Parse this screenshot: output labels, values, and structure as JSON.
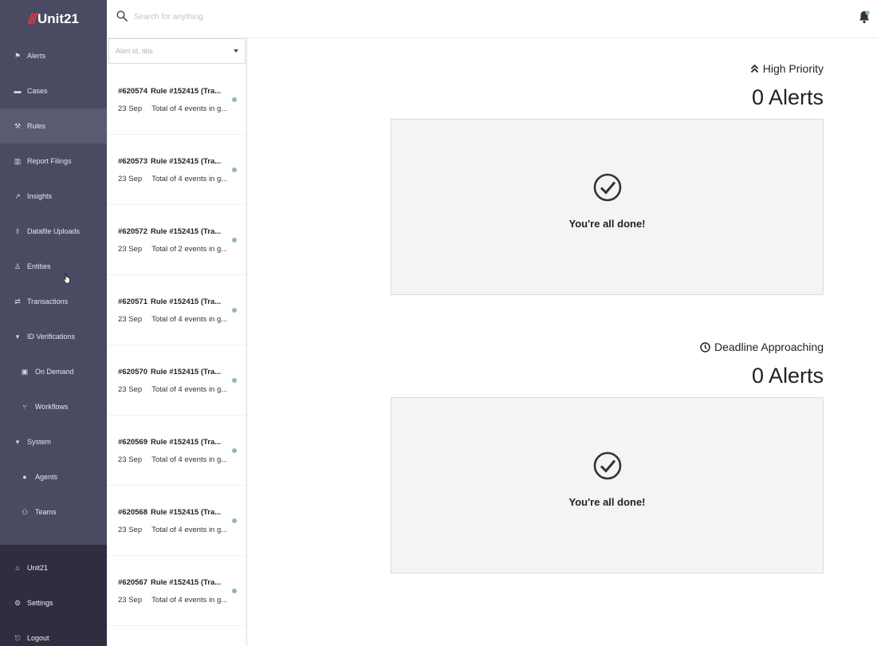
{
  "app": {
    "logo_mark": "///",
    "logo_text": "Unit21"
  },
  "search": {
    "placeholder": "Search for anything"
  },
  "sidebar": {
    "items": [
      {
        "label": "Alerts",
        "icon": "flag-icon",
        "glyph": "⚑"
      },
      {
        "label": "Cases",
        "icon": "briefcase-icon",
        "glyph": "▬"
      },
      {
        "label": "Rules",
        "icon": "gavel-icon",
        "glyph": "⚒"
      },
      {
        "label": "Report Filings",
        "icon": "bank-icon",
        "glyph": "▥"
      },
      {
        "label": "Insights",
        "icon": "chart-line-icon",
        "glyph": "↗"
      },
      {
        "label": "Datafile Uploads",
        "icon": "upload-icon",
        "glyph": "⇪"
      },
      {
        "label": "Entities",
        "icon": "person-icon",
        "glyph": "♙"
      },
      {
        "label": "Transactions",
        "icon": "exchange-icon",
        "glyph": "⇄"
      },
      {
        "label": "ID Verifications",
        "icon": "caret-down-icon",
        "glyph": "▾"
      },
      {
        "label": "On Demand",
        "icon": "id-card-icon",
        "glyph": "▣"
      },
      {
        "label": "Workflows",
        "icon": "branch-icon",
        "glyph": "⑂"
      },
      {
        "label": "System",
        "icon": "caret-down-icon",
        "glyph": "▾"
      },
      {
        "label": "Agents",
        "icon": "user-icon",
        "glyph": "●"
      },
      {
        "label": "Teams",
        "icon": "users-icon",
        "glyph": "⚇"
      }
    ],
    "bottom_items": [
      {
        "label": "Unit21",
        "icon": "home-icon",
        "glyph": "⌂"
      },
      {
        "label": "Settings",
        "icon": "gears-icon",
        "glyph": "⚙"
      },
      {
        "label": "Logout",
        "icon": "logout-icon",
        "glyph": "⎋"
      }
    ]
  },
  "alert_list": {
    "filter_placeholder": "Alert id, title",
    "rows": [
      {
        "id": "#620574",
        "title": "Rule #152415 (Tra...",
        "date": "23 Sep",
        "desc": "Total of 4 events in g..."
      },
      {
        "id": "#620573",
        "title": "Rule #152415 (Tra...",
        "date": "23 Sep",
        "desc": "Total of 4 events in g..."
      },
      {
        "id": "#620572",
        "title": "Rule #152415 (Tra...",
        "date": "23 Sep",
        "desc": "Total of 2 events in g..."
      },
      {
        "id": "#620571",
        "title": "Rule #152415 (Tra...",
        "date": "23 Sep",
        "desc": "Total of 4 events in g..."
      },
      {
        "id": "#620570",
        "title": "Rule #152415 (Tra...",
        "date": "23 Sep",
        "desc": "Total of 4 events in g..."
      },
      {
        "id": "#620569",
        "title": "Rule #152415 (Tra...",
        "date": "23 Sep",
        "desc": "Total of 4 events in g..."
      },
      {
        "id": "#620568",
        "title": "Rule #152415 (Tra...",
        "date": "23 Sep",
        "desc": "Total of 4 events in g..."
      },
      {
        "id": "#620567",
        "title": "Rule #152415 (Tra...",
        "date": "23 Sep",
        "desc": "Total of 4 events in g..."
      }
    ]
  },
  "high_priority": {
    "title": "High Priority",
    "count_label": "0 Alerts",
    "done_message": "You're all done!"
  },
  "deadline": {
    "title": "Deadline Approaching",
    "count_label": "0 Alerts",
    "done_message": "You're all done!"
  },
  "colors": {
    "sidebar_bg": "#4b4a63",
    "sidebar_bottom_bg": "#2f2e40",
    "logo_accent": "#e0354a",
    "status_dot": "#8fbf93"
  }
}
